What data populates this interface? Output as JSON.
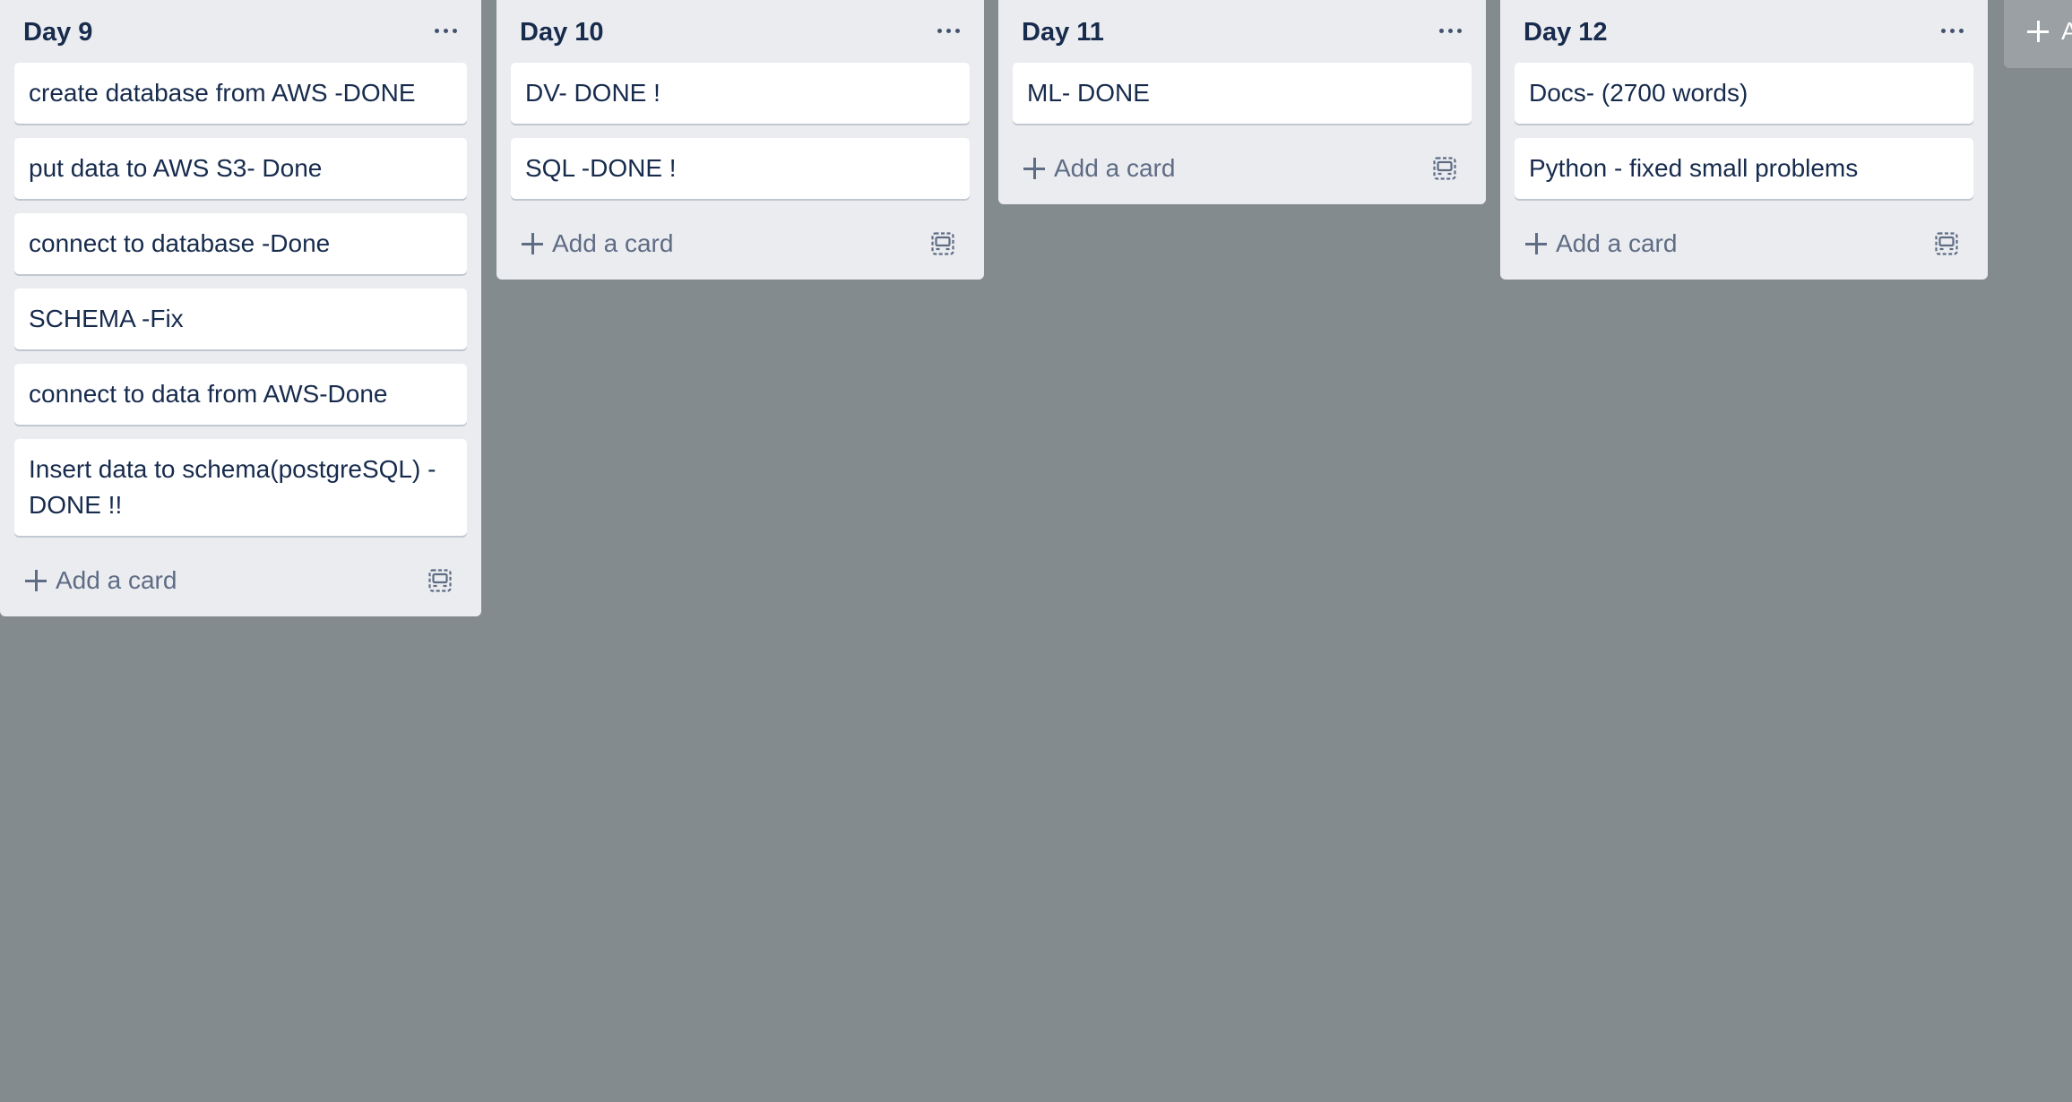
{
  "lists": [
    {
      "title": "Day 9",
      "cards": [
        "create database from AWS -DONE",
        "put data to AWS S3- Done",
        "connect to database -Done",
        "SCHEMA -Fix",
        "connect to data from AWS-Done",
        "Insert data to schema(postgreSQL) -DONE !!"
      ],
      "add_card_label": "Add a card"
    },
    {
      "title": "Day 10",
      "cards": [
        "DV- DONE !",
        "SQL -DONE !"
      ],
      "add_card_label": "Add a card"
    },
    {
      "title": "Day 11",
      "cards": [
        "ML- DONE"
      ],
      "add_card_label": "Add a card"
    },
    {
      "title": "Day 12",
      "cards": [
        "Docs- (2700 words)",
        "Python - fixed small problems"
      ],
      "add_card_label": "Add a card"
    }
  ],
  "add_list_label": "A",
  "colors": {
    "board_background": "#848b8f",
    "list_background": "#ebecf0",
    "card_background": "#ffffff",
    "text": "#172b4d",
    "muted_text": "#5e6c84"
  },
  "icons": {
    "list_menu": "ellipsis-icon",
    "add": "plus-icon",
    "template": "card-template-icon"
  }
}
